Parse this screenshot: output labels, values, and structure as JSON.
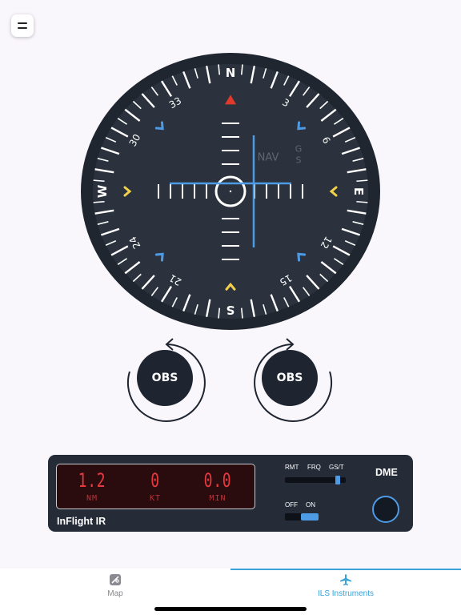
{
  "menu": {
    "icon": "hamburger-icon"
  },
  "compass": {
    "cardinals": [
      "N",
      "E",
      "S",
      "W"
    ],
    "numbers": [
      "3",
      "6",
      "12",
      "15",
      "21",
      "24",
      "30",
      "33"
    ],
    "nav_flag": "NAV",
    "gs_flag": "G\nS",
    "colors": {
      "bezel": "#1f2630",
      "face": "#2b323d",
      "needle": "#4d9be5",
      "lubber": "#e03a2c",
      "marker_yellow": "#f2d04a",
      "marker_blue": "#4d9be5"
    }
  },
  "obs": {
    "left_label": "OBS",
    "right_label": "OBS"
  },
  "dme": {
    "distance": "1.2",
    "distance_unit": "NM",
    "speed": "0",
    "speed_unit": "KT",
    "time": "0.0",
    "time_unit": "MIN",
    "brand": "InFlight IR",
    "mode_labels": [
      "RMT",
      "FRQ",
      "GS/T"
    ],
    "selected_mode": "GS/T",
    "power_labels": [
      "OFF",
      "ON"
    ],
    "power_state": "ON",
    "title": "DME"
  },
  "tabs": [
    {
      "label": "Map",
      "icon": "map-icon",
      "active": false
    },
    {
      "label": "ILS Instruments",
      "icon": "airplane-icon",
      "active": true
    }
  ]
}
